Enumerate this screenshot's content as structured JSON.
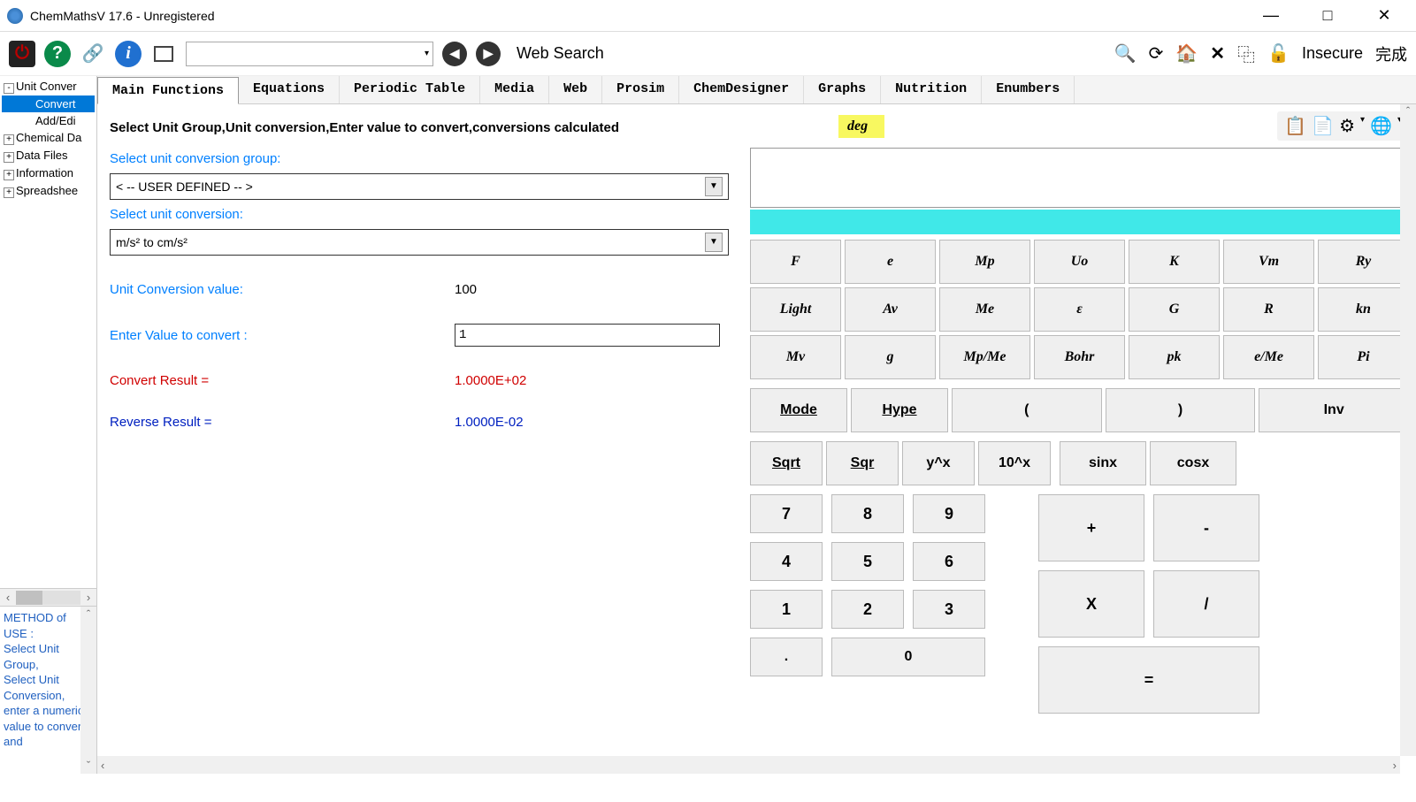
{
  "window": {
    "title": "ChemMathsV 17.6 - Unregistered"
  },
  "toolbar": {
    "web_search": "Web Search",
    "insecure": "Insecure",
    "done": "完成"
  },
  "tabs": [
    "Main Functions",
    "Equations",
    "Periodic Table",
    "Media",
    "Web",
    "Prosim",
    "ChemDesigner",
    "Graphs",
    "Nutrition",
    "Enumbers"
  ],
  "tree": {
    "items": [
      {
        "label": "Unit Conver",
        "exp": "-",
        "indent": 0
      },
      {
        "label": "Convert",
        "indent": 1,
        "selected": true
      },
      {
        "label": "Add/Edi",
        "indent": 1
      },
      {
        "label": "Chemical Da",
        "exp": "+",
        "indent": 0
      },
      {
        "label": "Data Files",
        "exp": "+",
        "indent": 0
      },
      {
        "label": "Information",
        "exp": "+",
        "indent": 0
      },
      {
        "label": "Spreadshee",
        "exp": "+",
        "indent": 0
      }
    ]
  },
  "help_text": "METHOD of USE :\nSelect Unit Group,\nSelect Unit Conversion, enter a numeric value to convert and",
  "conv": {
    "heading": "Select Unit Group,Unit conversion,Enter value to convert,conversions calculated",
    "label_group": "Select unit conversion group:",
    "group_value": "< -- USER DEFINED -- >",
    "label_conv": "Select unit conversion:",
    "conv_value": "m/s² to cm/s²",
    "label_conv_value": "Unit Conversion value:",
    "conv_value_num": "100",
    "label_enter": "Enter Value to convert :",
    "enter_value": "1",
    "label_result": "Convert Result =",
    "result_value": "1.0000E+02",
    "label_reverse": "Reverse Result =",
    "reverse_value": "1.0000E-02"
  },
  "calc": {
    "mode": "deg",
    "constants_row1": [
      "F",
      "e",
      "Mp",
      "Uo",
      "K",
      "Vm",
      "Ry"
    ],
    "constants_row2": [
      "Light",
      "Av",
      "Me",
      "ε",
      "G",
      "R",
      "kn"
    ],
    "constants_row3": [
      "Mv",
      "g",
      "Mp/Me",
      "Bohr",
      "pk",
      "e/Me",
      "Pi"
    ],
    "mode_btn": "Mode",
    "hype_btn": "Hype",
    "paren_open": "(",
    "paren_close": ")",
    "inv_btn": "Inv",
    "sqrt": "Sqrt",
    "sqr": "Sqr",
    "ypx": "y^x",
    "tenx": "10^x",
    "sinx": "sinx",
    "cosx": "cosx",
    "digits": [
      "7",
      "8",
      "9",
      "4",
      "5",
      "6",
      "1",
      "2",
      "3"
    ],
    "dot": ".",
    "zero": "0",
    "plus": "+",
    "minus": "-",
    "mult": "X",
    "div": "/",
    "eq": "="
  }
}
